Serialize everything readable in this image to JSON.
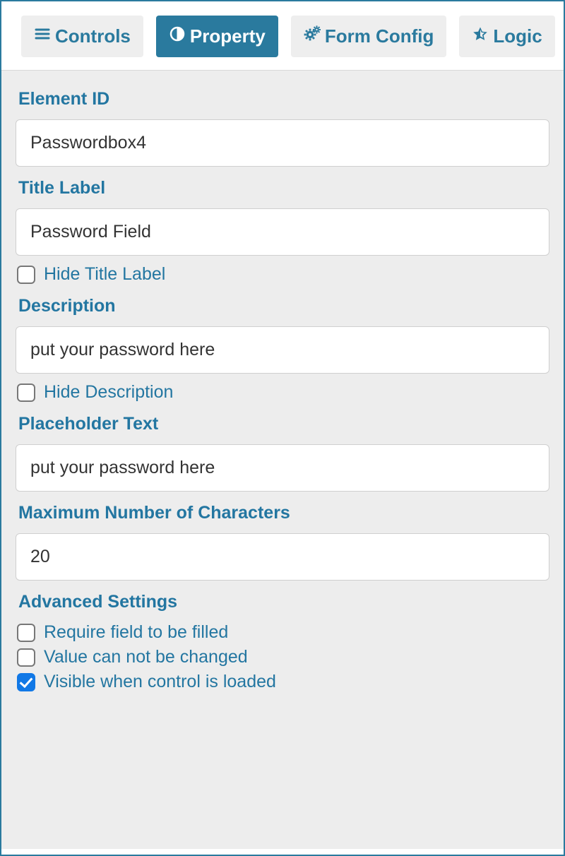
{
  "tabs": {
    "controls": "Controls",
    "property": "Property",
    "formConfig": "Form Config",
    "logic": "Logic",
    "active": "property"
  },
  "labels": {
    "elementId": "Element ID",
    "titleLabel": "Title Label",
    "hideTitle": "Hide Title Label",
    "description": "Description",
    "hideDescription": "Hide Description",
    "placeholder": "Placeholder Text",
    "maxChars": "Maximum Number of Characters",
    "advanced": "Advanced Settings",
    "requireFilled": "Require field to be filled",
    "readonly": "Value can not be changed",
    "visibleLoaded": "Visible when control is loaded"
  },
  "values": {
    "elementId": "Passwordbox4",
    "titleLabel": "Password Field",
    "description": "put your password here",
    "placeholder": "put your password here",
    "maxChars": "20"
  },
  "checks": {
    "hideTitle": false,
    "hideDescription": false,
    "requireFilled": false,
    "readonly": false,
    "visibleLoaded": true
  }
}
